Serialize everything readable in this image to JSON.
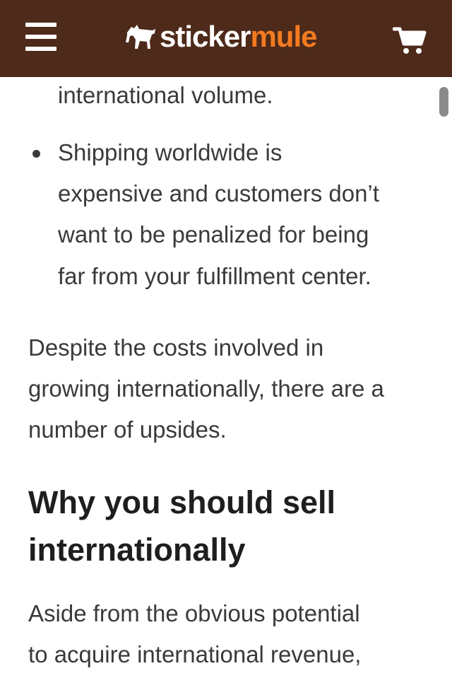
{
  "navbar": {
    "logo_sticker": "sticker",
    "logo_mule": "mule",
    "brand_color": "#4e2a1b",
    "accent_color": "#f47b20",
    "menu_icon": "hamburger-menu-icon",
    "cart_icon": "shopping-cart-icon"
  },
  "article": {
    "list_items": [
      {
        "lines": [
          "international volume."
        ]
      },
      {
        "lines": [
          "Shipping worldwide is",
          "expensive and customers don’t",
          "want to be penalized for being",
          "far from your fulfillment center."
        ]
      }
    ],
    "paragraph1": [
      "Despite the costs involved in",
      "growing internationally, there are a",
      "number of upsides."
    ],
    "heading": [
      "Why you should sell",
      "internationally"
    ],
    "paragraph2": [
      "Aside from the obvious potential",
      "to acquire international revenue,"
    ]
  }
}
